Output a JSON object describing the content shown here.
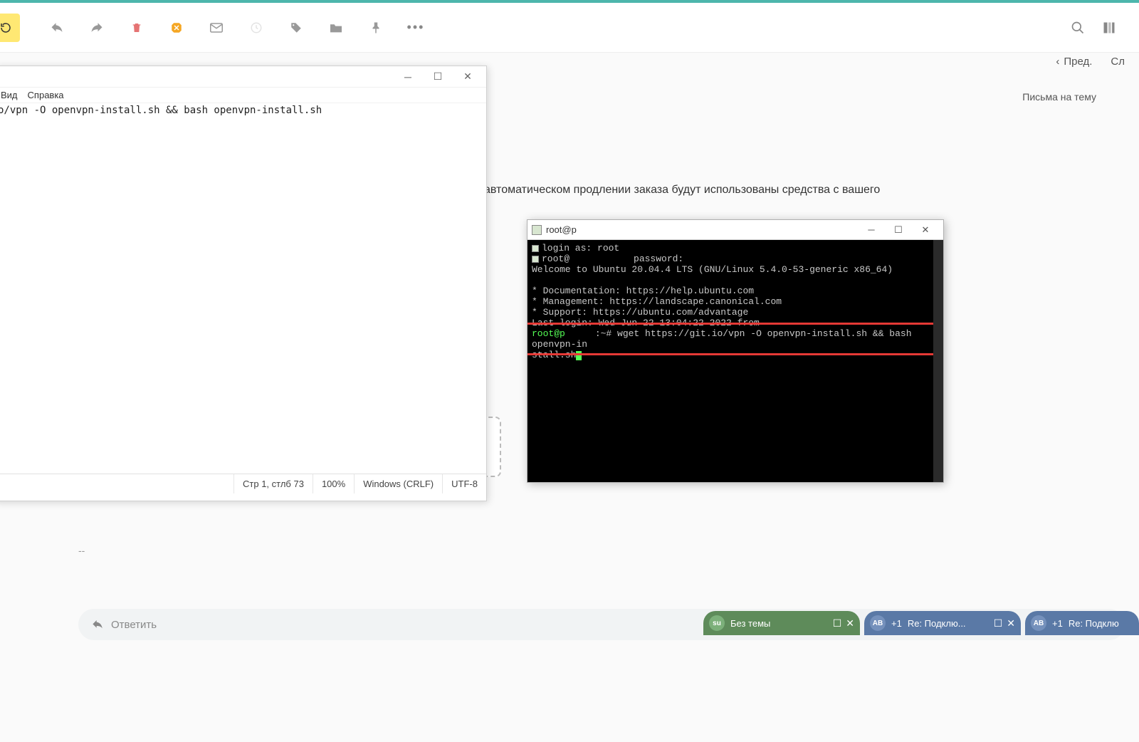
{
  "mail": {
    "toolbar": {
      "icons": [
        "compose",
        "refresh",
        "undo",
        "redo",
        "delete",
        "spam",
        "mail",
        "clock",
        "tag",
        "folder",
        "pin",
        "more"
      ]
    },
    "nav": {
      "prev_label": "Пред.",
      "next_label": "Сл"
    },
    "subject_line_label": "Письма на тему",
    "body_snippet": "автоматическом продлении заказа будут использованы средства с вашего",
    "reply_placeholder": "Ответить",
    "body_dashes": "--"
  },
  "notepad": {
    "menubar": {
      "view": "Вид",
      "help": "Справка"
    },
    "text_content": "o/vpn -O openvpn-install.sh && bash openvpn-install.sh",
    "statusbar": {
      "position": "Стр 1, стлб 73",
      "zoom": "100%",
      "line_ending": "Windows (CRLF)",
      "encoding": "UTF-8"
    }
  },
  "putty": {
    "title": "root@p",
    "lines": {
      "login_prompt": "login as: ",
      "login_user": "root",
      "pw_prompt_user": "root@",
      "pw_prompt_label": "password:",
      "welcome": "Welcome to Ubuntu 20.04.4 LTS (GNU/Linux 5.4.0-53-generic x86_64)",
      "doc": " * Documentation:  https://help.ubuntu.com",
      "mgmt": " * Management:     https://landscape.canonical.com",
      "support": " * Support:        https://ubuntu.com/advantage",
      "lastlogin": "Last login: Wed Jun 22 13:04:22 2022 from",
      "prompt_user": "root@p",
      "prompt_sep": ":~# ",
      "command": "wget https://git.io/vpn -O openvpn-install.sh && bash openvpn-in",
      "command_wrap": "stall.sh"
    }
  },
  "chat_tabs": [
    {
      "avatar": "su",
      "count": "",
      "label": "Без темы",
      "style": "green"
    },
    {
      "avatar": "АВ",
      "count": "+1",
      "label": "Re: Подклю...",
      "style": "blue"
    },
    {
      "avatar": "АВ",
      "count": "+1",
      "label": "Re: Подклю",
      "style": "blue"
    }
  ]
}
